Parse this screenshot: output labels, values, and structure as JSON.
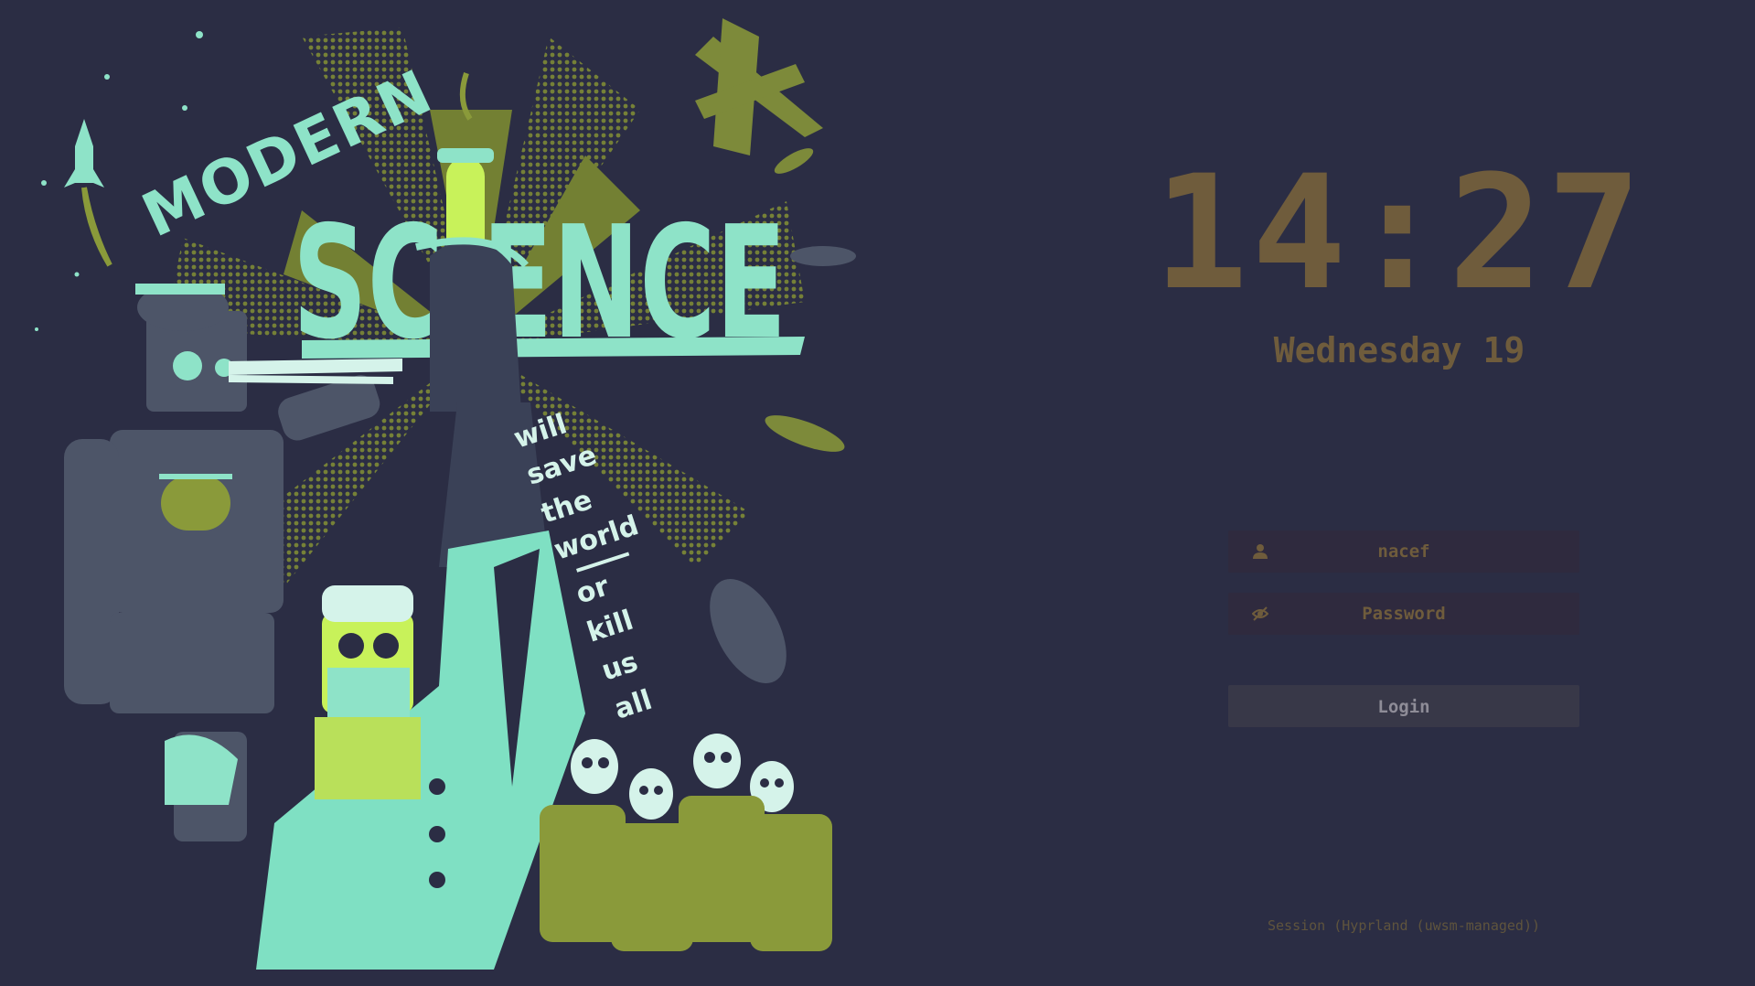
{
  "wallpaper": {
    "title_small": "MODERN",
    "title_large": "SCIENCE",
    "tagline": [
      "will",
      "save",
      "the",
      "world",
      "or",
      "kill",
      "us",
      "all"
    ]
  },
  "clock": {
    "time": "14:27",
    "date": "Wednesday 19"
  },
  "login": {
    "username": "nacef",
    "password_placeholder": "Password",
    "button_label": "Login",
    "user_icon": "user-icon",
    "password_icon": "eye-off-icon"
  },
  "session": {
    "label": "Session (Hyprland (uwsm-managed))"
  },
  "colors": {
    "background": "#2b2d44",
    "accent": "#6f5c3c",
    "field_bg": "#2f2a3e",
    "button_bg": "#383848",
    "poster_mint": "#8ee3c8",
    "poster_olive": "#8a9a3a",
    "poster_lime": "#c8f25a"
  }
}
